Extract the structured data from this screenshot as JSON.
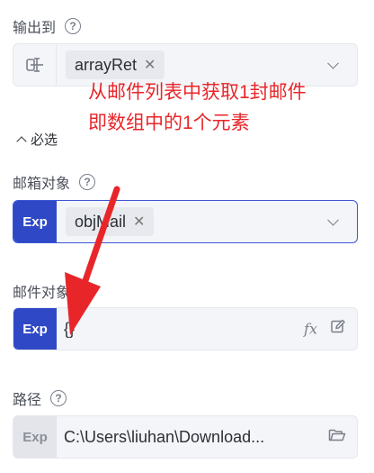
{
  "output": {
    "label": "输出到",
    "tag": "arrayRet"
  },
  "annotation": {
    "line1": "从邮件列表中获取1封邮件",
    "line2": "即数组中的1个元素"
  },
  "required_toggle": "必选",
  "mailbox": {
    "label": "邮箱对象",
    "badge": "Exp",
    "tag": "objMail"
  },
  "mail_object": {
    "label": "邮件对象",
    "badge": "Exp",
    "value": "{}"
  },
  "path": {
    "label": "路径",
    "badge": "Exp",
    "value": "C:\\Users\\liuhan\\Download..."
  },
  "icons": {
    "help": "help-circle-icon",
    "variable": "variable-icon",
    "fx": "fx-icon",
    "edit": "edit-icon",
    "folder": "folder-icon",
    "chevron": "chevron-down-icon"
  },
  "colors": {
    "accent": "#2f49c6",
    "annotation": "#e8262a"
  }
}
